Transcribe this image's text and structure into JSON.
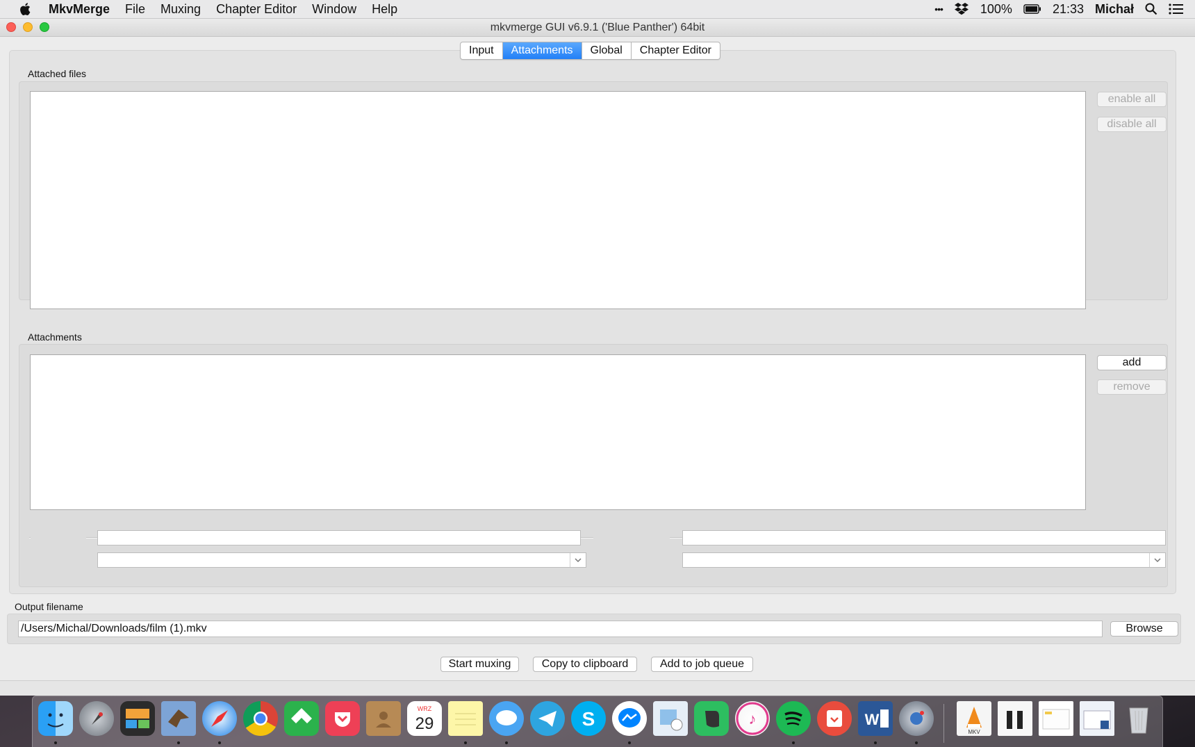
{
  "menubar": {
    "app_name": "MkvMerge",
    "menus": [
      "File",
      "Muxing",
      "Chapter Editor",
      "Window",
      "Help"
    ],
    "overflow": "•••",
    "battery_text": "100%",
    "clock": "21:33",
    "user": "Michał"
  },
  "window": {
    "title": "mkvmerge GUI v6.9.1 ('Blue Panther') 64bit",
    "tabs": [
      {
        "label": "Input",
        "active": false
      },
      {
        "label": "Attachments",
        "active": true
      },
      {
        "label": "Global",
        "active": false
      },
      {
        "label": "Chapter Editor",
        "active": false
      }
    ],
    "attached_files": {
      "label": "Attached files",
      "enable_all": "enable all",
      "disable_all": "disable all"
    },
    "attachments": {
      "label": "Attachments",
      "add": "add",
      "remove": "remove"
    },
    "output": {
      "label": "Output filename",
      "value": "/Users/Michal/Downloads/film (1).mkv",
      "browse": "Browse"
    },
    "actions": {
      "start": "Start muxing",
      "copy": "Copy to clipboard",
      "queue": "Add to job queue"
    }
  },
  "dock": {
    "calendar_month": "WRZ",
    "calendar_day": "29",
    "vlc_label": "MKV",
    "items": [
      "finder-icon",
      "launchpad-icon",
      "photo-slideshow-icon",
      "mail-icon",
      "safari-icon",
      "chrome-icon",
      "feedly-icon",
      "pocket-icon",
      "contacts-icon",
      "calendar-icon",
      "notes-icon",
      "messages-icon",
      "telegram-icon",
      "skype-icon",
      "messenger-icon",
      "preview-icon",
      "evernote-icon",
      "itunes-icon",
      "spotify-icon",
      "transmit-icon",
      "word-icon",
      "disk-utility-icon"
    ]
  },
  "colors": {
    "accent": "#2280f7",
    "close": "#fc5f57",
    "minimize": "#fdbc2e",
    "maximize": "#28c840"
  }
}
